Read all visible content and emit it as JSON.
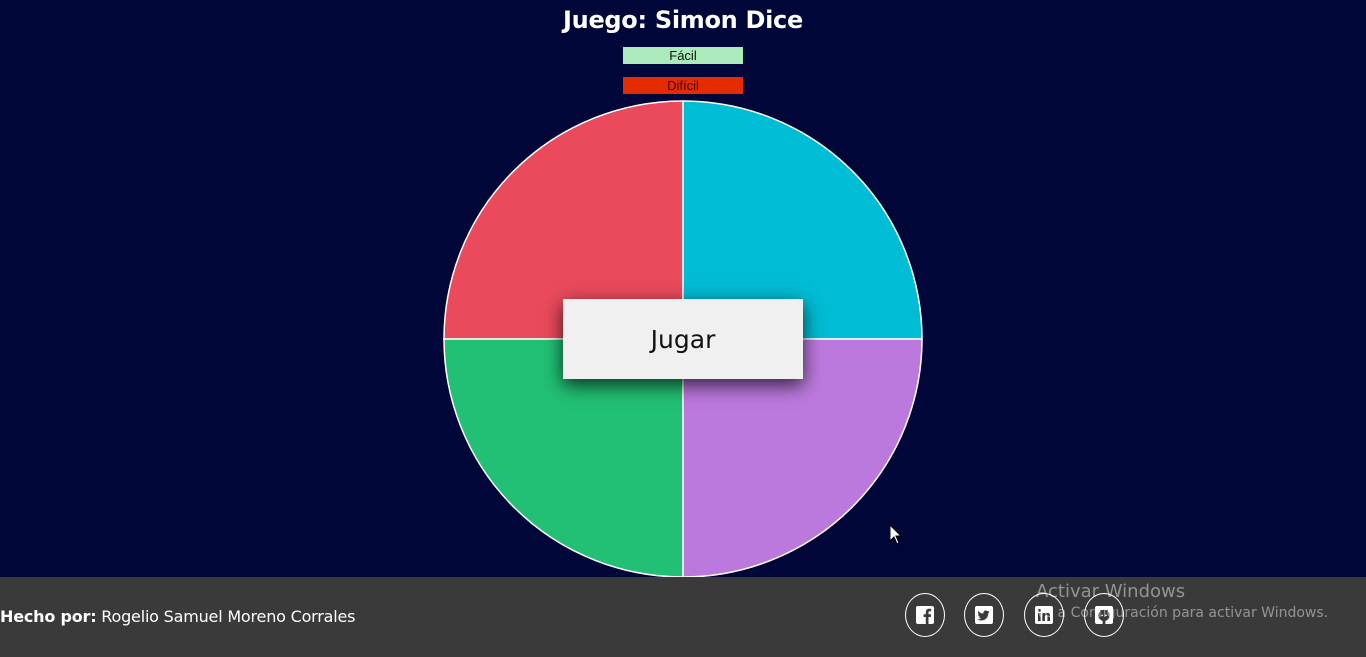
{
  "header": {
    "title": "Juego: Simon Dice"
  },
  "levels": {
    "easy_label": "Fácil",
    "hard_label": "Difícil"
  },
  "board": {
    "quadrants": [
      {
        "position": "top-left",
        "color": "#ea4a5c"
      },
      {
        "position": "top-right",
        "color": "#00bcd4"
      },
      {
        "position": "bottom-left",
        "color": "#22c074"
      },
      {
        "position": "bottom-right",
        "color": "#bb79dd"
      }
    ]
  },
  "play": {
    "label": "Jugar"
  },
  "footer": {
    "credit_label": "Hecho por:",
    "credit_name": " Rogelio Samuel Moreno Corrales",
    "social_icons": [
      "facebook-icon",
      "twitter-icon",
      "linkedin-icon",
      "github-icon"
    ]
  },
  "watermark": {
    "title": "Activar Windows",
    "subtitle": "Ve a Configuración para activar Windows."
  }
}
